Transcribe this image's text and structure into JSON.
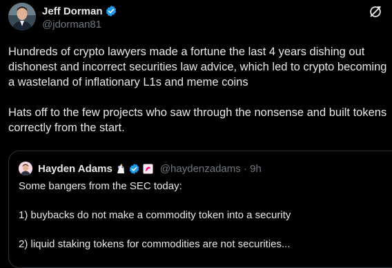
{
  "author": {
    "name": "Jeff Dorman",
    "handle": "@jdorman81"
  },
  "tweet": {
    "paragraphs": [
      "Hundreds of crypto lawyers made a fortune the last 4 years dishing out dishonest and incorrect securities law advice, which led to crypto becoming a wasteland of inflationary L1s and meme coins",
      "Hats off to the few projects who saw through the nonsense and built tokens correctly from the start."
    ]
  },
  "quoted": {
    "name": "Hayden Adams",
    "handle_time": "@haydenzadams · 9h",
    "lines": [
      "Some bangers from the SEC today:",
      "1) buybacks do not make a commodity token into a security",
      "2) liquid staking tokens for commodities are not securities..."
    ]
  },
  "colors": {
    "background": "#000000",
    "text": "#e7e9ea",
    "secondary": "#71767b",
    "verified": "#1d9bf0",
    "border": "#2f3336"
  },
  "icons": [
    "verified-badge-icon",
    "grok-icon",
    "unicorn-emoji-icon",
    "uniswap-badge-icon"
  ]
}
